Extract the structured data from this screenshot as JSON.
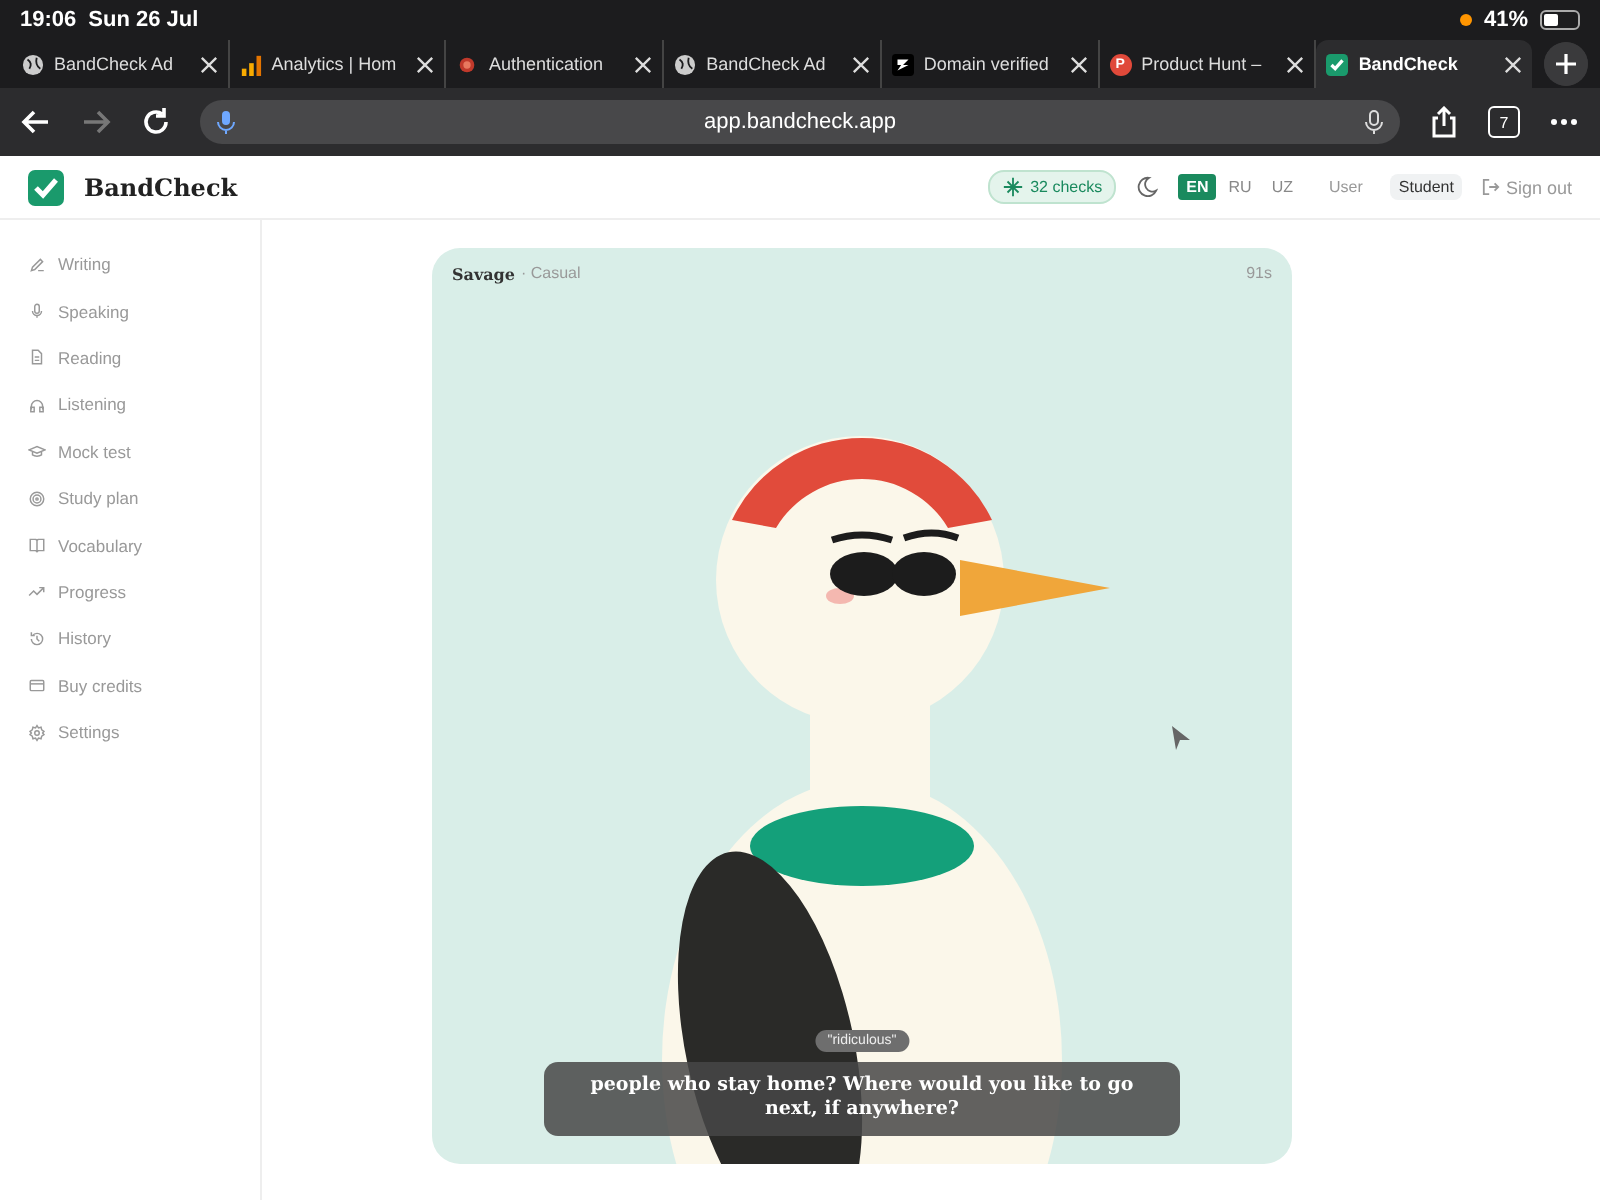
{
  "status_bar": {
    "time": "19:06",
    "date": "Sun 26 Jul",
    "battery": "41%"
  },
  "tabs": [
    {
      "title": "BandCheck Ad",
      "kind": "globe",
      "selected": false
    },
    {
      "title": "Analytics | Hom",
      "kind": "chart",
      "selected": false
    },
    {
      "title": "Authentication",
      "kind": "dot",
      "selected": false
    },
    {
      "title": "BandCheck Ad",
      "kind": "globe",
      "selected": false
    },
    {
      "title": "Domain verified",
      "kind": "logo",
      "selected": false
    },
    {
      "title": "Product Hunt –",
      "kind": "letter",
      "icon_text": "P",
      "selected": false
    },
    {
      "title": "BandCheck",
      "kind": "check",
      "selected": true
    }
  ],
  "address_bar": {
    "url": "app.bandcheck.app",
    "tab_count": "7"
  },
  "header": {
    "brand": "BandCheck",
    "checks": "32 checks",
    "languages": [
      {
        "label": "EN",
        "selected": true
      },
      {
        "label": "RU",
        "selected": false
      },
      {
        "label": "UZ",
        "selected": false
      }
    ],
    "roles": [
      {
        "label": "User",
        "selected": false
      },
      {
        "label": "Student",
        "selected": true
      }
    ],
    "sign_out": "Sign out"
  },
  "sidebar": {
    "items": [
      {
        "label": "Writing",
        "kind": "pen"
      },
      {
        "label": "Speaking",
        "kind": "mic"
      },
      {
        "label": "Reading",
        "kind": "doc"
      },
      {
        "label": "Listening",
        "kind": "headphones"
      },
      {
        "label": "Mock test",
        "kind": "cap"
      },
      {
        "label": "Study plan",
        "kind": "target"
      },
      {
        "label": "Vocabulary",
        "kind": "book"
      },
      {
        "label": "Progress",
        "kind": "trend"
      },
      {
        "label": "History",
        "kind": "history"
      },
      {
        "label": "Buy credits",
        "kind": "card"
      },
      {
        "label": "Settings",
        "kind": "gear"
      }
    ]
  },
  "card": {
    "persona": "Savage",
    "style": "· Casual",
    "timer": "91s",
    "word": "\"ridiculous\"",
    "caption": "people who stay home? Where would you like to go next, if anywhere?"
  }
}
